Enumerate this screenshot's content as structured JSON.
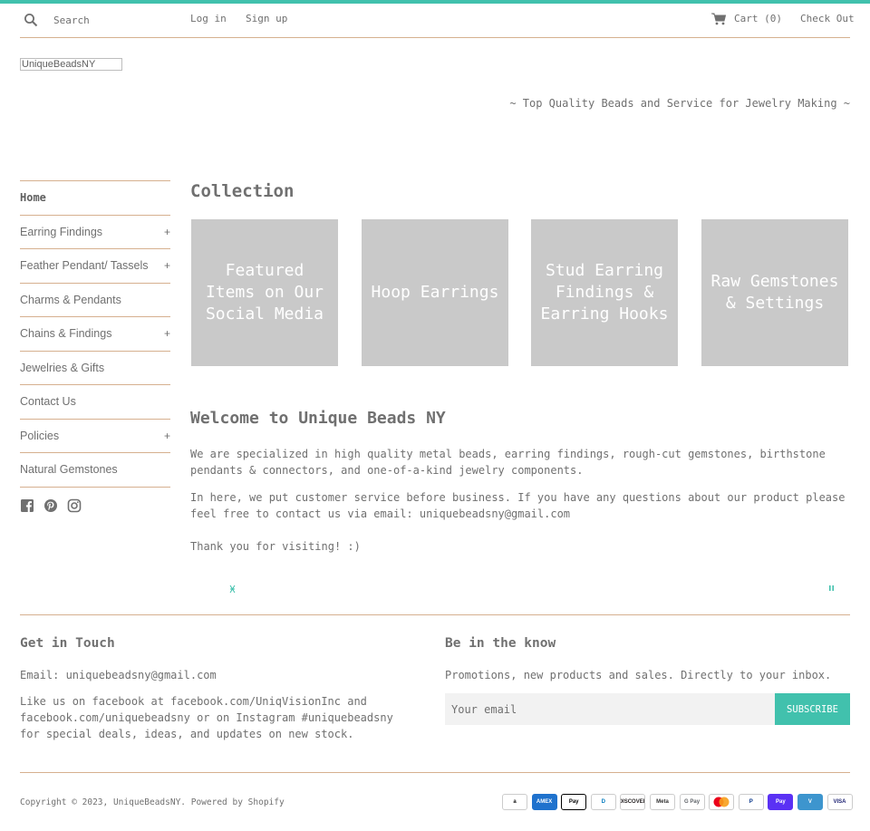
{
  "colors": {
    "accent": "#41c1ad",
    "divider": "#d6b08f",
    "tile": "#c9c9c9",
    "text": "#707070"
  },
  "header": {
    "search_placeholder": "Search",
    "login": "Log in",
    "signup": "Sign up",
    "cart": "Cart (0)",
    "checkout": "Check Out"
  },
  "logo_alt": "UniqueBeadsNY",
  "tagline": "~ Top Quality Beads and Service for Jewelry Making ~",
  "sidebar": {
    "items": [
      {
        "label": "Home",
        "expandable": false,
        "active": true
      },
      {
        "label": "Earring Findings",
        "expandable": true
      },
      {
        "label": "Feather Pendant/ Tassels",
        "expandable": true
      },
      {
        "label": "Charms & Pendants",
        "expandable": false
      },
      {
        "label": "Chains & Findings",
        "expandable": true
      },
      {
        "label": "Jewelries & Gifts",
        "expandable": false
      },
      {
        "label": "Contact Us",
        "expandable": false
      },
      {
        "label": "Policies",
        "expandable": true
      },
      {
        "label": "Natural Gemstones",
        "expandable": false
      }
    ],
    "expand_symbol": "+",
    "social_icons": [
      "facebook-icon",
      "pinterest-icon",
      "instagram-icon"
    ]
  },
  "collection": {
    "title": "Collection",
    "tiles": [
      {
        "label": "Featured Items on Our Social Media"
      },
      {
        "label": "Hoop Earrings"
      },
      {
        "label": "Stud Earring Findings & Earring Hooks"
      },
      {
        "label": "Raw Gemstones & Settings"
      }
    ]
  },
  "welcome": {
    "title": "Welcome to Unique Beads NY",
    "para1": "We are specialized in high quality metal beads, earring findings, rough-cut gemstones, birthstone pendants & connectors, and one-of-a-kind jewelry components.",
    "para2": "In here, we put customer service before business. If you have any questions about our product please feel free to contact us via email: uniquebeadsny@gmail.com",
    "para3": "Thank you for visiting! :)"
  },
  "footer": {
    "touch_title": "Get in Touch",
    "touch_email": "Email: uniquebeadsny@gmail.com",
    "touch_social": "Like us on facebook at facebook.com/UniqVisionInc and facebook.com/uniquebeadsny or on Instagram #uniquebeadsny for special deals, ideas, and updates on new stock.",
    "know_title": "Be in the know",
    "know_text": "Promotions, new products and sales. Directly to your inbox.",
    "email_placeholder": "Your email",
    "subscribe_label": "SUBSCRIBE",
    "copyright": "Copyright © 2023, UniqueBeadsNY. Powered by Shopify"
  },
  "payments": [
    {
      "name": "amazon-icon",
      "label": "a",
      "bg": "#ffffff",
      "fg": "#111111",
      "border": "#cccccc"
    },
    {
      "name": "amex-icon",
      "label": "AMEX",
      "bg": "#1f72cd",
      "fg": "#ffffff",
      "border": "#1f72cd"
    },
    {
      "name": "apple-pay-icon",
      "label": "Pay",
      "bg": "#ffffff",
      "fg": "#000000",
      "border": "#000000"
    },
    {
      "name": "diners-club-icon",
      "label": "D",
      "bg": "#ffffff",
      "fg": "#0079be",
      "border": "#cccccc"
    },
    {
      "name": "discover-icon",
      "label": "DISCOVER",
      "bg": "#ffffff",
      "fg": "#231f20",
      "border": "#cccccc"
    },
    {
      "name": "meta-pay-icon",
      "label": "Meta",
      "bg": "#ffffff",
      "fg": "#333333",
      "border": "#cccccc"
    },
    {
      "name": "google-pay-icon",
      "label": "G Pay",
      "bg": "#ffffff",
      "fg": "#5f6368",
      "border": "#cccccc"
    },
    {
      "name": "mastercard-icon",
      "label": "",
      "bg": "#ffffff",
      "fg": "#000000",
      "border": "#cccccc"
    },
    {
      "name": "paypal-icon",
      "label": "P",
      "bg": "#ffffff",
      "fg": "#003087",
      "border": "#cccccc"
    },
    {
      "name": "shop-pay-icon",
      "label": "Pay",
      "bg": "#5a31f4",
      "fg": "#ffffff",
      "border": "#5a31f4"
    },
    {
      "name": "venmo-icon",
      "label": "V",
      "bg": "#3d95ce",
      "fg": "#ffffff",
      "border": "#3d95ce"
    },
    {
      "name": "visa-icon",
      "label": "VISA",
      "bg": "#ffffff",
      "fg": "#1a1f71",
      "border": "#cccccc"
    }
  ]
}
